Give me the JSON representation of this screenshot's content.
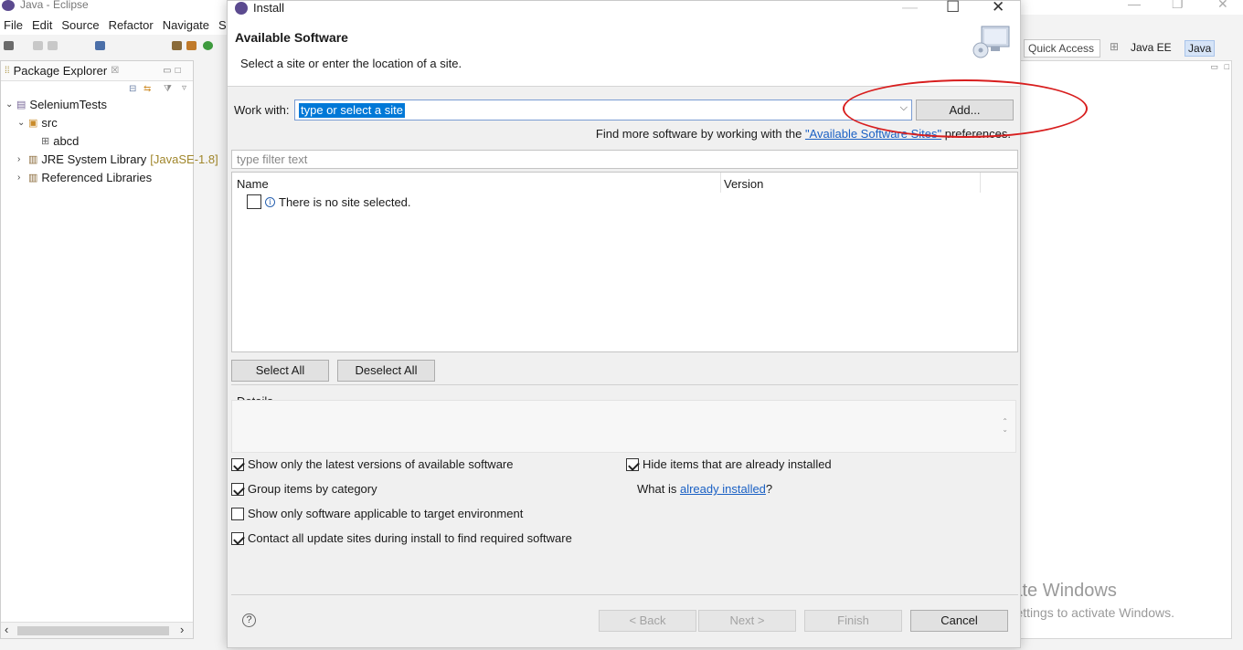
{
  "eclipse": {
    "title": "Java - Eclipse",
    "menu": [
      "File",
      "Edit",
      "Source",
      "Refactor",
      "Navigate",
      "Sea"
    ],
    "package_explorer": {
      "title": "Package Explorer",
      "close_glyph": "☒",
      "tree": {
        "project": "SeleniumTests",
        "src": "src",
        "package": "abcd",
        "jre_label": "JRE System Library",
        "jre_version": "[JavaSE-1.8]",
        "ref_libs": "Referenced Libraries"
      }
    },
    "quick_access": "Quick Access",
    "perspectives": [
      "Java EE",
      "Java"
    ],
    "active_perspective": "Java"
  },
  "dialog": {
    "title": "Install",
    "banner_title": "Available Software",
    "banner_subtitle": "Select a site or enter the location of a site.",
    "work_with_label": "Work with:",
    "work_with_value": "type or select a site",
    "add_button": "Add...",
    "find_more_prefix": "Find more software by working with the ",
    "find_more_link": "\"Available Software Sites\"",
    "find_more_suffix": " preferences.",
    "filter_placeholder": "type filter text",
    "columns": [
      "Name",
      "Version"
    ],
    "no_site_msg": "There is no site selected.",
    "select_all": "Select All",
    "deselect_all": "Deselect All",
    "details_label": "Details",
    "options_left": [
      {
        "label": "Show only the latest versions of available software",
        "checked": true
      },
      {
        "label": "Group items by category",
        "checked": true
      },
      {
        "label": "Show only software applicable to target environment",
        "checked": false
      },
      {
        "label": "Contact all update sites during install to find required software",
        "checked": true
      }
    ],
    "hide_installed": {
      "label": "Hide items that are already installed",
      "checked": true
    },
    "what_is_prefix": "What is ",
    "what_is_link": "already installed",
    "what_is_suffix": "?",
    "back_button": "< Back",
    "next_button": "Next >",
    "finish_button": "Finish",
    "cancel_button": "Cancel"
  },
  "watermark": {
    "line1": "Activate Windows",
    "line2": "Go to Settings to activate Windows."
  },
  "colors": {
    "annotation_ellipse": "#d81e1e",
    "link": "#1a60c4",
    "selection": "#0078d7"
  }
}
